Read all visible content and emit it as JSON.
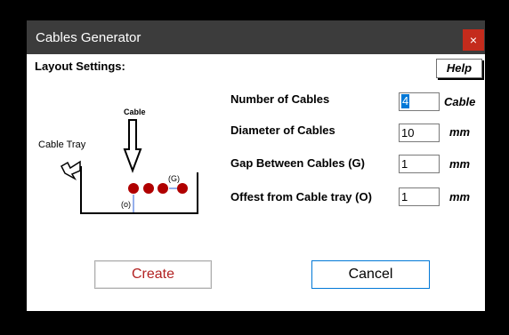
{
  "window": {
    "title": "Cables Generator",
    "close_glyph": "×",
    "close_icon": "close-icon"
  },
  "layout": {
    "section_label": "Layout Settings:",
    "help_label": "Help"
  },
  "diagram": {
    "cable_label": "Cable",
    "tray_label": "Cable Tray",
    "gap_label": "(G)",
    "offset_label": "(o)",
    "cable_color": "#b00000"
  },
  "fields": {
    "number_of_cables": {
      "label": "Number of Cables",
      "value": "4",
      "unit": "Cable"
    },
    "diameter": {
      "label": "Diameter of Cables",
      "value": "10",
      "unit": "mm"
    },
    "gap": {
      "label": "Gap Between Cables (G)",
      "value": "1",
      "unit": "mm"
    },
    "offset": {
      "label": "Offest from Cable tray (O)",
      "value": "1",
      "unit": "mm"
    }
  },
  "buttons": {
    "create": "Create",
    "cancel": "Cancel"
  },
  "colors": {
    "titlebar": "#3c3c3c",
    "close": "#c42b1c",
    "create_text": "#b22222",
    "focus_border": "#0078d7"
  }
}
